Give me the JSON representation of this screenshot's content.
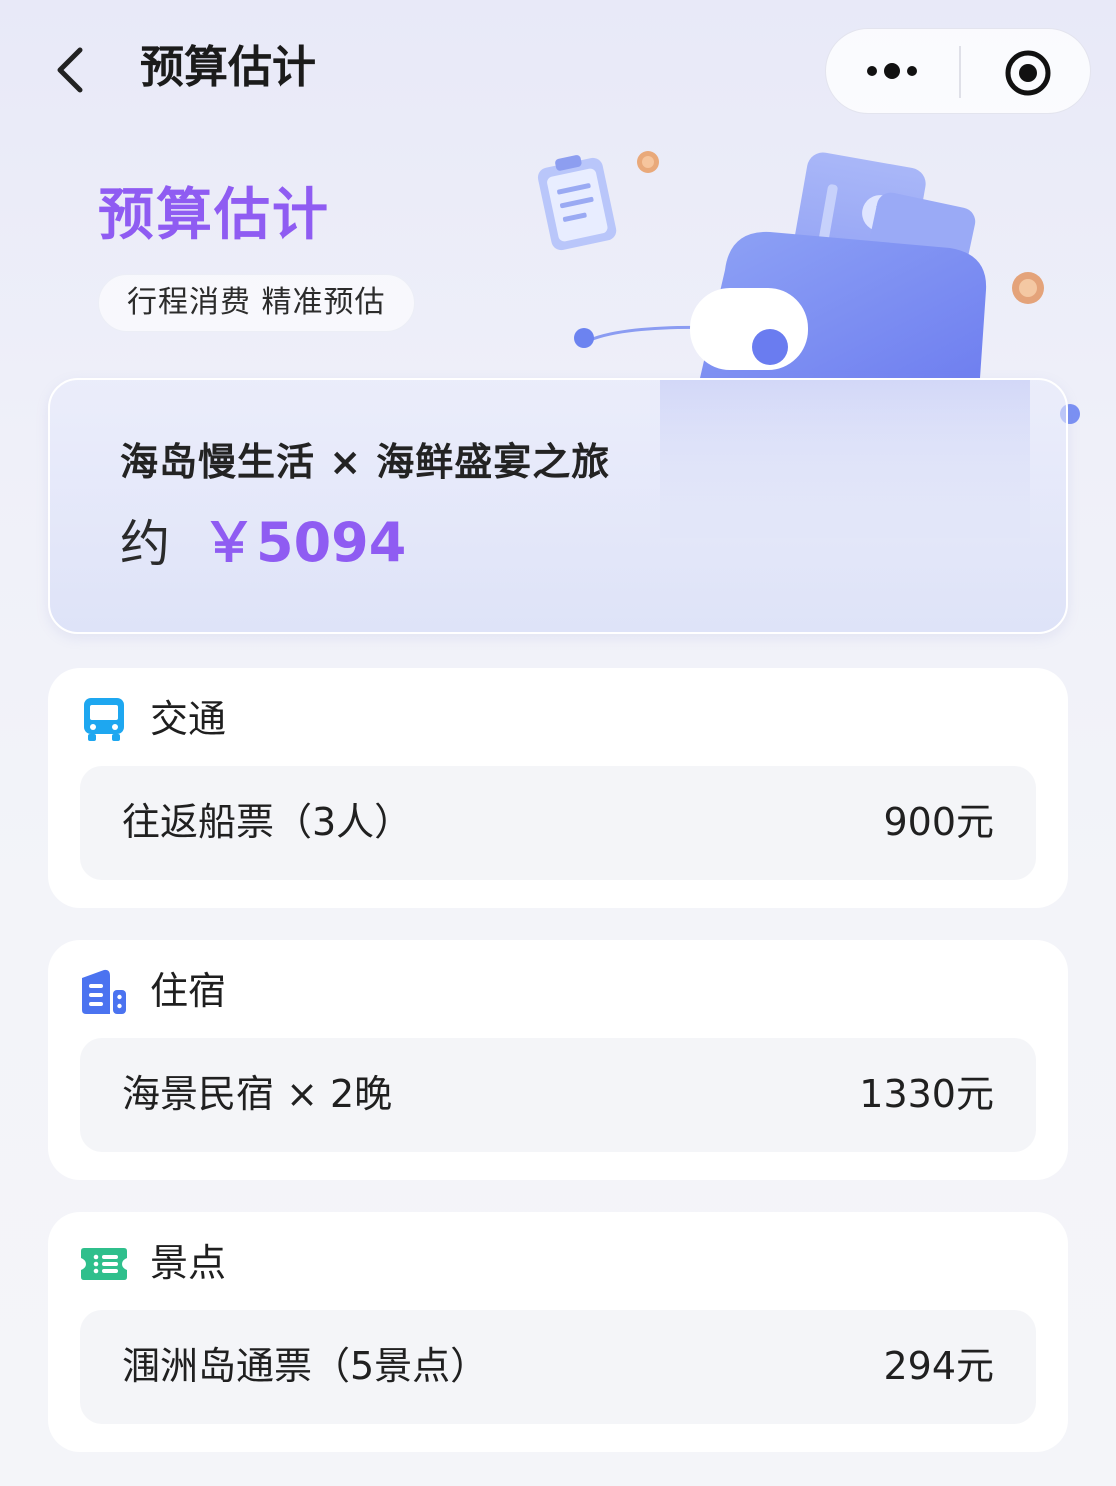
{
  "header": {
    "title": "预算估计"
  },
  "hero": {
    "title": "预算估计",
    "subtitle": "行程消费 精准预估"
  },
  "summary": {
    "trip_name": "海岛慢生活 × 海鲜盛宴之旅",
    "approx_label": "约",
    "total": "￥5094"
  },
  "sections": [
    {
      "title": "交通",
      "icon": "bus-icon",
      "icon_color": "#1ea7f0",
      "items": [
        {
          "label": "往返船票（3人）",
          "price": "900元"
        }
      ]
    },
    {
      "title": "住宿",
      "icon": "hotel-building-icon",
      "icon_color": "#4b73f0",
      "items": [
        {
          "label": "海景民宿 × 2晚",
          "price": "1330元"
        }
      ]
    },
    {
      "title": "景点",
      "icon": "ticket-icon",
      "icon_color": "#2fbf8c",
      "items": [
        {
          "label": "涠洲岛通票（5景点）",
          "price": "294元"
        }
      ]
    }
  ],
  "colors": {
    "accent": "#8f5cf2",
    "card_bg": "#ffffff",
    "row_bg": "#f4f5f8"
  }
}
